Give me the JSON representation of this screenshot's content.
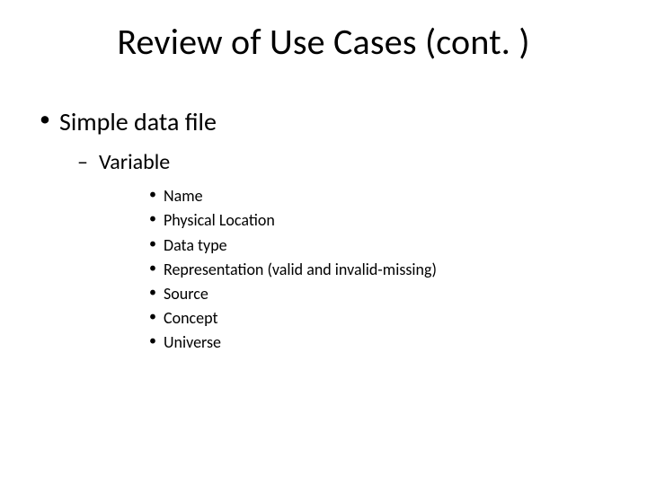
{
  "title": "Review of Use Cases (cont. )",
  "bullets": {
    "lvl1": [
      {
        "text": "Simple data file",
        "lvl2": [
          {
            "text": "Variable",
            "lvl3": [
              "Name",
              "Physical Location",
              "Data type",
              "Representation (valid and invalid-missing)",
              "Source",
              "Concept",
              "Universe"
            ]
          }
        ]
      }
    ]
  }
}
